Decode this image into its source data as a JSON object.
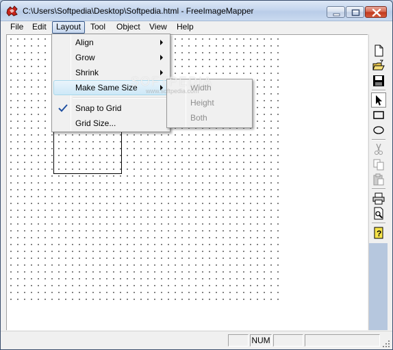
{
  "window": {
    "title": "C:\\Users\\Softpedia\\Desktop\\Softpedia.html - FreeImageMapper"
  },
  "menubar": {
    "items": [
      {
        "label": "File"
      },
      {
        "label": "Edit"
      },
      {
        "label": "Layout",
        "active": true
      },
      {
        "label": "Tool"
      },
      {
        "label": "Object"
      },
      {
        "label": "View"
      },
      {
        "label": "Help"
      }
    ]
  },
  "layout_menu": {
    "items": [
      {
        "label": "Align",
        "submenu": true
      },
      {
        "label": "Grow",
        "submenu": true
      },
      {
        "label": "Shrink",
        "submenu": true
      },
      {
        "label": "Make Same Size",
        "submenu": true,
        "highlighted": true
      },
      {
        "label": "Snap to Grid",
        "checked": true
      },
      {
        "label": "Grid Size..."
      }
    ]
  },
  "make_same_size_submenu": {
    "items": [
      {
        "label": "Width",
        "enabled": false
      },
      {
        "label": "Height",
        "enabled": false
      },
      {
        "label": "Both",
        "enabled": false
      }
    ]
  },
  "toolbar": {
    "buttons": [
      {
        "icon": "new-document-icon"
      },
      {
        "icon": "open-folder-icon"
      },
      {
        "icon": "save-icon"
      },
      {
        "icon": "select-arrow-icon"
      },
      {
        "icon": "rectangle-tool-icon"
      },
      {
        "icon": "ellipse-tool-icon"
      },
      {
        "icon": "cut-icon"
      },
      {
        "icon": "copy-icon"
      },
      {
        "icon": "paste-icon"
      },
      {
        "icon": "print-icon"
      },
      {
        "icon": "print-preview-icon"
      },
      {
        "icon": "help-icon"
      }
    ]
  },
  "statusbar": {
    "panes": [
      "",
      "NUM",
      "",
      ""
    ]
  },
  "watermark": {
    "text": "SOFTPEDIA",
    "subtext": "www.softpedia.com"
  },
  "colors": {
    "accent_highlight": "#cde8f7",
    "checkmark": "#1f4fa0",
    "titlebar": "#c5d6ee",
    "toolbar_lower": "#b6c7de"
  }
}
